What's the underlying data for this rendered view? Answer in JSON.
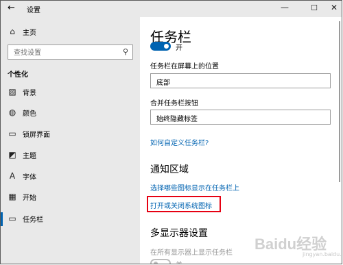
{
  "window": {
    "title": "设置",
    "back_icon": "←",
    "minimize_icon": "—",
    "maximize_icon": "☐",
    "close_icon": "✕"
  },
  "sidebar": {
    "home": {
      "label": "主页",
      "icon": "⌂"
    },
    "search": {
      "placeholder": "查找设置",
      "icon": "⚲"
    },
    "section_title": "个性化",
    "items": [
      {
        "label": "背景",
        "icon": "▨"
      },
      {
        "label": "颜色",
        "icon": "◍"
      },
      {
        "label": "锁屏界面",
        "icon": "▭"
      },
      {
        "label": "主题",
        "icon": "◩"
      },
      {
        "label": "字体",
        "icon": "A"
      },
      {
        "label": "开始",
        "icon": "▦"
      },
      {
        "label": "任务栏",
        "icon": "▭",
        "active": true
      }
    ],
    "accent_color": "#0063b1"
  },
  "main": {
    "title": "任务栏",
    "lock_toggle": {
      "state": "开",
      "on": true
    },
    "position_label": "任务栏在屏幕上的位置",
    "position_value": "底部",
    "combine_label": "合并任务栏按钮",
    "combine_value": "始终隐藏标签",
    "customize_link": "如何自定义任务栏?",
    "notification_heading": "通知区域",
    "select_icons_link": "选择哪些图标显示在任务栏上",
    "system_icons_link": "打开或关闭系统图标",
    "multi_display_heading": "多显示器设置",
    "show_all_displays_label": "在所有显示器上显示任务栏",
    "multi_toggle": {
      "state": "关",
      "on": false
    },
    "highlight_color": "#e60012"
  },
  "watermark": {
    "text": "Baidu经验",
    "sub": "jingyan.baidu.com"
  }
}
